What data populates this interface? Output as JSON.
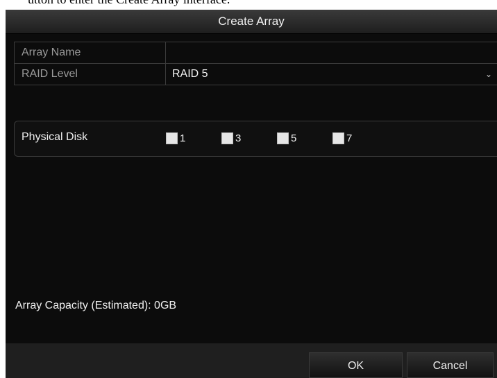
{
  "caption": "utton to enter the Create Array interface.",
  "dialog": {
    "title": "Create Array",
    "fields": [
      {
        "label": "Array Name",
        "value": ""
      },
      {
        "label": "RAID Level",
        "value": "RAID 5"
      }
    ],
    "physical_disk": {
      "label": "Physical Disk",
      "disks": [
        "1",
        "3",
        "5",
        "7"
      ],
      "checked": [
        false,
        false,
        false,
        false
      ]
    },
    "capacity": "Array Capacity (Estimated): 0GB",
    "buttons": {
      "ok": "OK",
      "cancel": "Cancel"
    }
  },
  "colors": {
    "dialog_bg": "#0c0c0c",
    "titlebar": "#2c2c2c",
    "footer": "#1f1f1f",
    "text": "#f0f0f0",
    "label_text": "#9a9a9a"
  },
  "icons": [
    "chevron-down-icon",
    "checkbox-icon"
  ]
}
